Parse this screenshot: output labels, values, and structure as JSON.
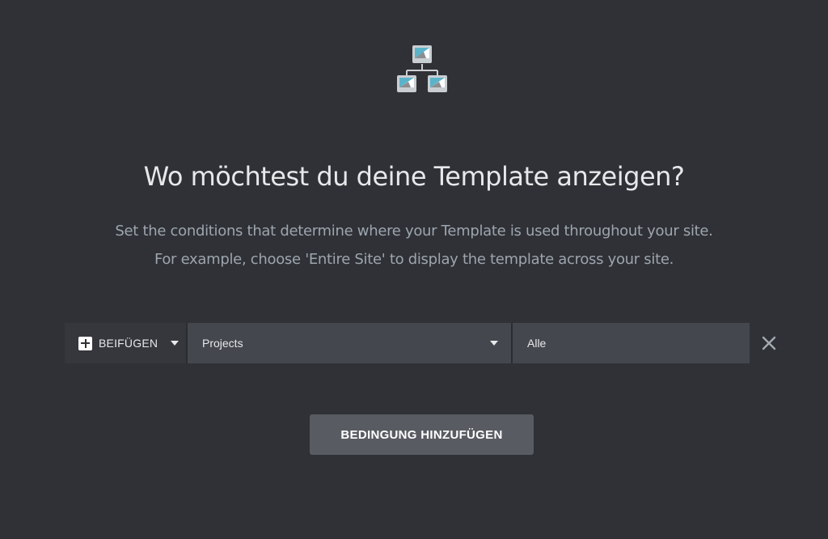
{
  "header": {
    "icon": "sitemap-icon",
    "title": "Wo möchtest du deine Template anzeigen?",
    "description_line1": "Set the conditions that determine where your Template is used throughout your site.",
    "description_line2": "For example, choose 'Entire Site' to display the template across your site."
  },
  "condition": {
    "include_label": "BEIFÜGEN",
    "include_icon": "plus-icon",
    "main_value": "Projects",
    "sub_value": "Alle",
    "remove_icon": "close-icon"
  },
  "actions": {
    "add_condition_label": "BEDINGUNG HINZUFÜGEN"
  },
  "colors": {
    "background": "#2f3136",
    "select_background": "#45474e",
    "include_background": "#35373c",
    "button_background": "#585b62",
    "icon_accent": "#5bb3c9"
  }
}
